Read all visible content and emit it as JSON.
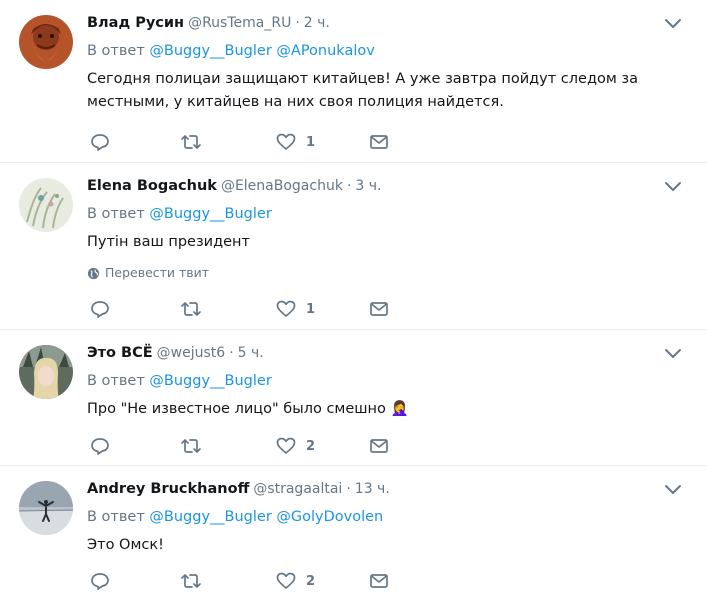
{
  "tweets": [
    {
      "name": "Влад Русин",
      "handle": "@RusTema_RU",
      "time": "2 ч.",
      "reply_prefix": "В ответ",
      "mentions": [
        "@Buggy__Bugler",
        "@APonukalov"
      ],
      "text": "Сегодня полицаи защищают китайцев! А уже завтра пойдут следом за местными, у китайцев на них своя полиция найдется.",
      "likes": "1"
    },
    {
      "name": "Elena Bogachuk",
      "handle": "@ElenaBogachuk",
      "time": "3 ч.",
      "reply_prefix": "В ответ",
      "mentions": [
        "@Buggy__Bugler"
      ],
      "text": "Путін ваш президент",
      "translate": "Перевести твит",
      "likes": "1"
    },
    {
      "name": "Это ВСЁ",
      "handle": "@wejust6",
      "time": "5 ч.",
      "reply_prefix": "В ответ",
      "mentions": [
        "@Buggy__Bugler"
      ],
      "text": "Про \"Не известное лицо\" было смешно 🤦‍♀️",
      "likes": "2"
    },
    {
      "name": "Andrey Bruckhanoff",
      "handle": "@stragaaltai",
      "time": "13 ч.",
      "reply_prefix": "В ответ",
      "mentions": [
        "@Buggy__Bugler",
        "@GolyDovolen"
      ],
      "text": "Это Омск!",
      "likes": "2"
    }
  ],
  "separator": "·",
  "colors": {
    "link": "#1b95e0",
    "meta": "#657786",
    "text": "#14171a",
    "divider": "#e6ecf0"
  },
  "icons": [
    "reply-icon",
    "retweet-icon",
    "like-icon",
    "direct-message-icon",
    "chevron-down-icon",
    "globe-icon"
  ]
}
